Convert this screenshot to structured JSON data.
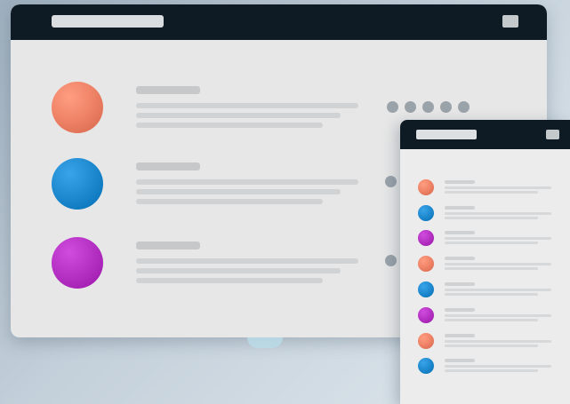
{
  "main_window": {
    "rows": [
      {
        "avatar_color": "#ec7f63"
      },
      {
        "avatar_color": "#1b86cc"
      },
      {
        "avatar_color": "#b12ec0"
      }
    ],
    "pagination_dots": 5
  },
  "mobile_window": {
    "rows": [
      {
        "avatar_color": "#ec7f63"
      },
      {
        "avatar_color": "#1b86cc"
      },
      {
        "avatar_color": "#b12ec0"
      },
      {
        "avatar_color": "#ec7f63"
      },
      {
        "avatar_color": "#1b86cc"
      },
      {
        "avatar_color": "#b12ec0"
      },
      {
        "avatar_color": "#ec7f63"
      },
      {
        "avatar_color": "#1b86cc"
      }
    ]
  },
  "colors": {
    "titlebar": "#0f1b24",
    "window_bg": "#e7e7e7",
    "dot": "#9aa2aa"
  },
  "icons": {
    "menu": "menu-icon"
  }
}
